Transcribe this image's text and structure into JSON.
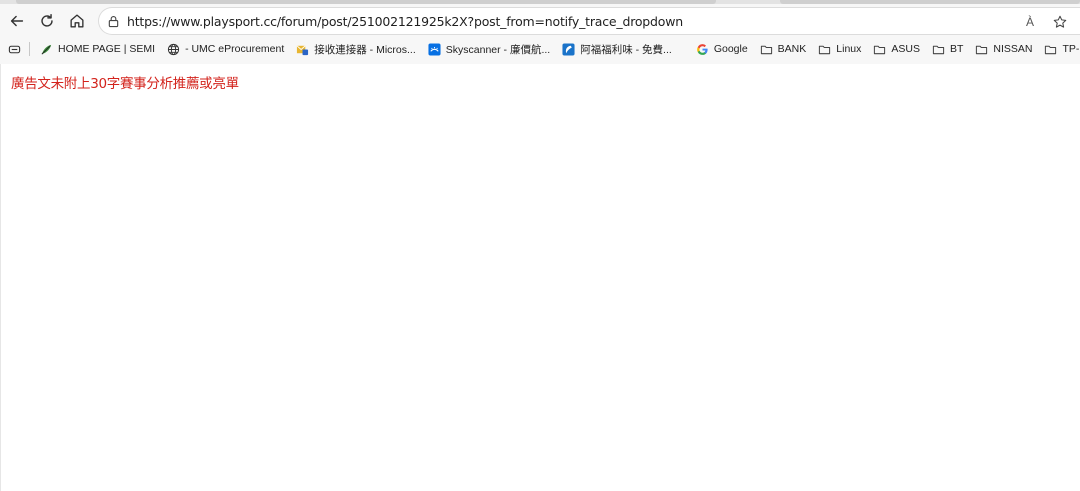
{
  "address_bar": {
    "url": "https://www.playsport.cc/forum/post/251002121925k2X?post_from=notify_trace_dropdown",
    "read_aloud_label": "À"
  },
  "bookmarks": [
    {
      "label": "HOME PAGE | SEMI",
      "icon": "leaf-logo-icon"
    },
    {
      "label": "- UMC eProcurement",
      "icon": "globe-icon"
    },
    {
      "label": "接收連接器 - Micros...",
      "icon": "outlook-icon"
    },
    {
      "label": "Skyscanner - 廉價航...",
      "icon": "skyscanner-icon"
    },
    {
      "label": "阿福福利味 - 免費...",
      "icon": "afu-icon"
    },
    {
      "label": "Google",
      "icon": "google-icon"
    },
    {
      "label": "BANK",
      "icon": "folder-icon"
    },
    {
      "label": "Linux",
      "icon": "folder-icon"
    },
    {
      "label": "ASUS",
      "icon": "folder-icon"
    },
    {
      "label": "BT",
      "icon": "folder-icon"
    },
    {
      "label": "NISSAN",
      "icon": "folder-icon"
    },
    {
      "label": "TP-Link",
      "icon": "folder-icon"
    }
  ],
  "page": {
    "notice": "廣告文未附上30字賽事分析推薦或亮單"
  },
  "colors": {
    "notice_text": "#d3231c",
    "chrome_bg": "#f7f7f7",
    "folder_icon": "#444444"
  }
}
